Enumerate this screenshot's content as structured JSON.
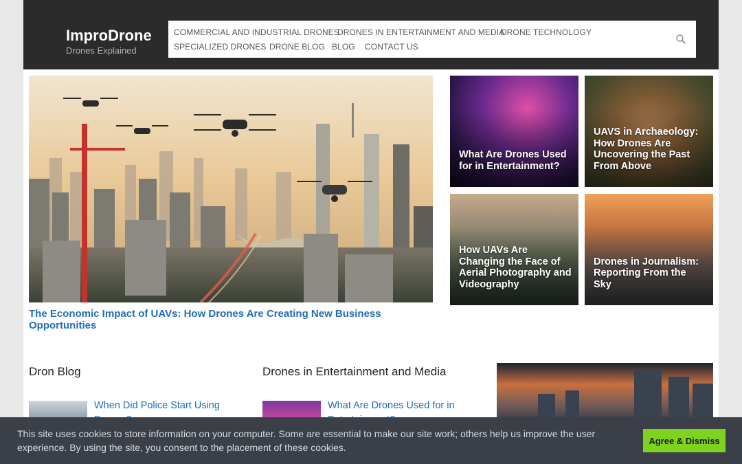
{
  "site": {
    "title": "ImproDrone",
    "tagline": "Drones Explained"
  },
  "nav": {
    "items": [
      "COMMERCIAL AND INDUSTRIAL DRONES",
      "DRONES IN ENTERTAINMENT AND MEDIA",
      "DRONE TECHNOLOGY",
      "SPECIALIZED DRONES",
      "DRONE BLOG",
      "BLOG",
      "CONTACT US"
    ],
    "search_icon": "search-icon"
  },
  "hero": {
    "title": "The Economic Impact of UAVs: How Drones Are Creating New Business Opportunities"
  },
  "tiles": [
    {
      "title": "What Are Drones Used for in Entertainment?"
    },
    {
      "title": "UAVS in Archaeology: How Drones Are Uncovering the Past From Above"
    },
    {
      "title": "How UAVs Are Changing the Face of Aerial Photography and Videography"
    },
    {
      "title": "Drones in Journalism: Reporting From the Sky"
    }
  ],
  "sections": {
    "blog": {
      "heading": "Dron Blog",
      "first_link": "When Did Police Start Using Drones?"
    },
    "entertainment": {
      "heading": "Drones in Entertainment and Media",
      "first_link": "What Are Drones Used for in Entertainment?"
    }
  },
  "cookie": {
    "text": "This site uses cookies to store information on your computer. Some are essential to make our site work; others help us improve the user experience. By using the site, you consent to the placement of these cookies.",
    "button": "Agree & Dismiss"
  },
  "colors": {
    "header_bg": "#2b2b2b",
    "link_blue": "#1f6db5",
    "cookie_bg": "#3a3f48",
    "cookie_button": "#7ed321"
  }
}
